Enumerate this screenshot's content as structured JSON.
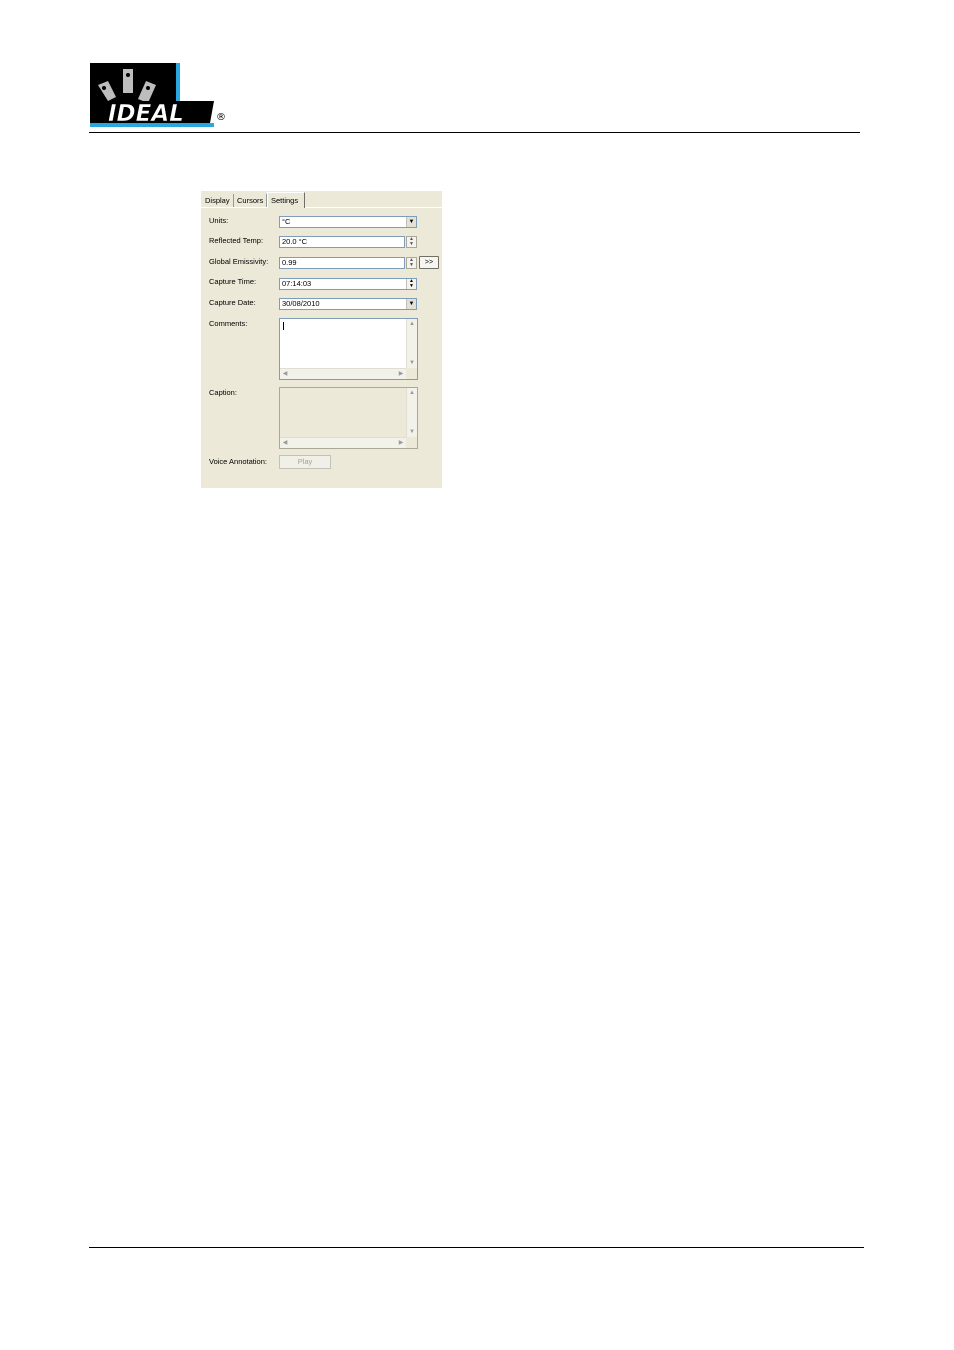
{
  "logo": {
    "text": "IDEAL",
    "trademark": "®",
    "colors": {
      "bar": "#000000",
      "accent": "#29a8e0",
      "text": "#ffffff"
    }
  },
  "panel": {
    "tabs": [
      {
        "label": "Display"
      },
      {
        "label": "Cursors"
      },
      {
        "label": "Settings",
        "active": true
      }
    ],
    "units": {
      "label": "Units:",
      "value": "°C"
    },
    "reflected_temp": {
      "label": "Reflected Temp:",
      "value": "20.0 °C"
    },
    "global_emissivity": {
      "label": "Global Emissivity:",
      "value": "0.99",
      "more_label": ">>"
    },
    "capture_time": {
      "label": "Capture Time:",
      "value": "07:14:03"
    },
    "capture_date": {
      "label": "Capture Date:",
      "value": "30/08/2010"
    },
    "comments": {
      "label": "Comments:",
      "value": ""
    },
    "caption": {
      "label": "Caption:",
      "value": ""
    },
    "voice_annotation": {
      "label": "Voice Annotation:",
      "play_label": "Play"
    }
  }
}
